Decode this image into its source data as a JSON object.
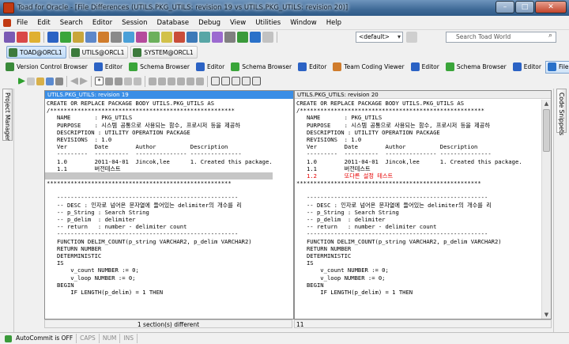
{
  "window": {
    "title": "Toad for Oracle - [File Differences (UTILS.PKG_UTILS: revision 19 vs UTILS.PKG_UTILS: revision 20)]"
  },
  "menu": [
    "File",
    "Edit",
    "Search",
    "Editor",
    "Session",
    "Database",
    "Debug",
    "View",
    "Utilities",
    "Window",
    "Help"
  ],
  "toolbar": {
    "schema_dropdown": "<default>",
    "search_placeholder": "Search Toad World"
  },
  "connections": [
    "TOAD@ORCL1",
    "UTILS@ORCL1",
    "SYSTEM@ORCL1"
  ],
  "window_tabs": [
    "Version Control Browser",
    "Editor",
    "Schema Browser",
    "Editor",
    "Schema Browser",
    "Editor",
    "Team Coding Viewer",
    "Editor",
    "Schema Browser",
    "Editor",
    "File Differences"
  ],
  "side_tabs": {
    "left": "Project Manager",
    "right": "Code Snippets"
  },
  "left_pane": {
    "header": "UTILS.PKG_UTILS: revision 19",
    "lines": [
      {
        "t": "CREATE OR REPLACE PACKAGE BODY UTILS.PKG_UTILS AS"
      },
      {
        "t": "/******************************************************"
      },
      {
        "t": "   NAME       : PKG_UTILS"
      },
      {
        "t": "   PURPOSE    : 시스템 공통으로 사용되는 함수, 프로시저 등을 제공하"
      },
      {
        "t": "   DESCRIPTION : UTILITY OPERATION PACKAGE"
      },
      {
        "t": "   REVISIONS  : 1.0"
      },
      {
        "t": "   Ver        Date        Author          Description"
      },
      {
        "t": "   ---------  ----------  --------------- ---------------"
      },
      {
        "t": "   1.0        2011-04-01  Jincok,lee      1. Created this package."
      },
      {
        "t": "   1.1        버전테스트"
      },
      {
        "t": "",
        "s": "grey"
      },
      {
        "t": "******************************************************"
      },
      {
        "t": ""
      },
      {
        "t": "   -----------------------------------------------------"
      },
      {
        "t": "   -- DESC : 인자로 넘어온 문자열에 들어있는 delimiter의 개수를 리"
      },
      {
        "t": "   -- p_String : Search String"
      },
      {
        "t": "   -- p_delim  : delimiter"
      },
      {
        "t": "   -- return   : number - delimiter count"
      },
      {
        "t": "   -----------------------------------------------------"
      },
      {
        "t": "   FUNCTION DELIM_COUNT(p_string VARCHAR2, p_delim VARCHAR2)"
      },
      {
        "t": "   RETURN NUMBER"
      },
      {
        "t": "   DETERMINISTIC"
      },
      {
        "t": "   IS"
      },
      {
        "t": "       v_count NUMBER := 0;"
      },
      {
        "t": "       v_loop NUMBER := 0;"
      },
      {
        "t": "   BEGIN"
      },
      {
        "t": "       IF LENGTH(p_delim) = 1 THEN"
      }
    ],
    "status": "1 section(s) different"
  },
  "right_pane": {
    "header": "UTILS.PKG_UTILS: revision 20",
    "lines": [
      {
        "t": "CREATE OR REPLACE PACKAGE BODY UTILS.PKG_UTILS AS"
      },
      {
        "t": "/******************************************************"
      },
      {
        "t": "   NAME       : PKG_UTILS"
      },
      {
        "t": "   PURPOSE    : 시스템 공통으로 사용되는 함수, 프로시저 등을 제공하"
      },
      {
        "t": "   DESCRIPTION : UTILITY OPERATION PACKAGE"
      },
      {
        "t": "   REVISIONS  : 1.0"
      },
      {
        "t": "   Ver        Date        Author          Description"
      },
      {
        "t": "   ---------  ----------  --------------- ---------------"
      },
      {
        "t": "   1.0        2011-04-01  Jincok,lee      1. Created this package."
      },
      {
        "t": "   1.1        버전테스트"
      },
      {
        "t": "   1.2        또다른 설정 테스트",
        "s": "red"
      },
      {
        "t": "******************************************************"
      },
      {
        "t": ""
      },
      {
        "t": "   -----------------------------------------------------"
      },
      {
        "t": "   -- DESC : 인자로 넘어온 문자열에 들어있는 delimiter의 개수를 리"
      },
      {
        "t": "   -- p_String : Search String"
      },
      {
        "t": "   -- p_delim  : delimiter"
      },
      {
        "t": "   -- return   : number - delimiter count"
      },
      {
        "t": "   -----------------------------------------------------"
      },
      {
        "t": "   FUNCTION DELIM_COUNT(p_string VARCHAR2, p_delim VARCHAR2)"
      },
      {
        "t": "   RETURN NUMBER"
      },
      {
        "t": "   DETERMINISTIC"
      },
      {
        "t": "   IS"
      },
      {
        "t": "       v_count NUMBER := 0;"
      },
      {
        "t": "       v_loop NUMBER := 0;"
      },
      {
        "t": "   BEGIN"
      },
      {
        "t": "       IF LENGTH(p_delim) = 1 THEN"
      }
    ],
    "status": "11"
  },
  "statusbar": {
    "autocommit": "AutoCommit is OFF",
    "caps": "CAPS",
    "num": "NUM",
    "ins": "INS"
  },
  "colors": {
    "accent": "#3a8ee6",
    "diff_added": "#e60000",
    "diff_gap": "#c6c6c6"
  }
}
